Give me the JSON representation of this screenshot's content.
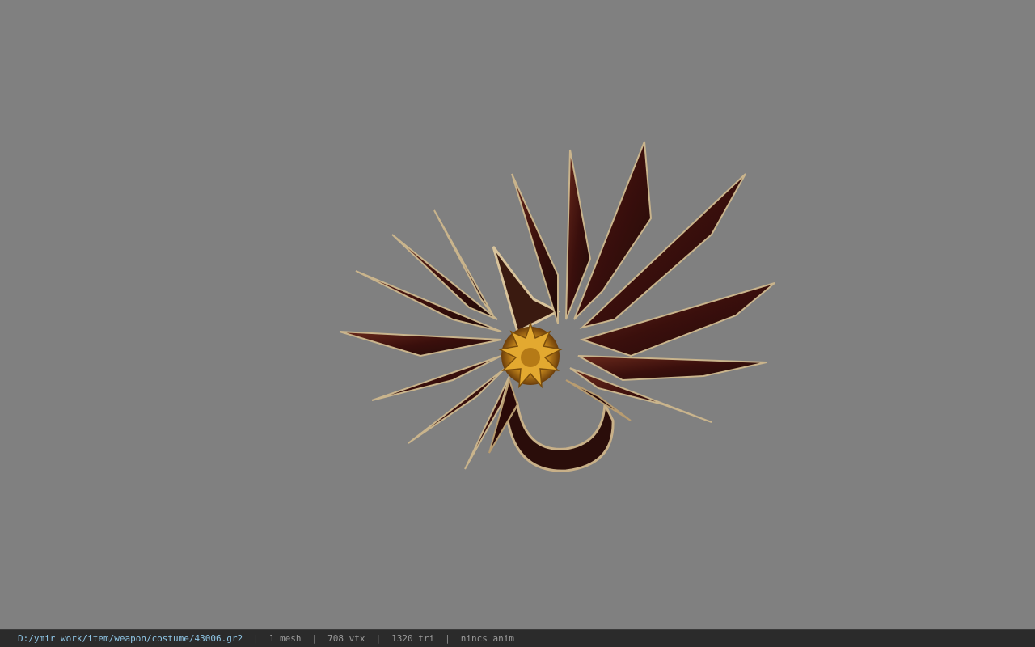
{
  "viewer": {
    "background_color": "#808080",
    "model_icon": "ornate-weapon-model"
  },
  "status_bar": {
    "file_path": "D:/ymir work/item/weapon/costume/43006.gr2",
    "separator": "|",
    "mesh_count": "1 mesh",
    "vertex_count": "708 vtx",
    "triangle_count": "1320 tri",
    "animation": "nincs anim",
    "path_color": "#8fc6e6",
    "text_color": "#9a9a9a"
  }
}
